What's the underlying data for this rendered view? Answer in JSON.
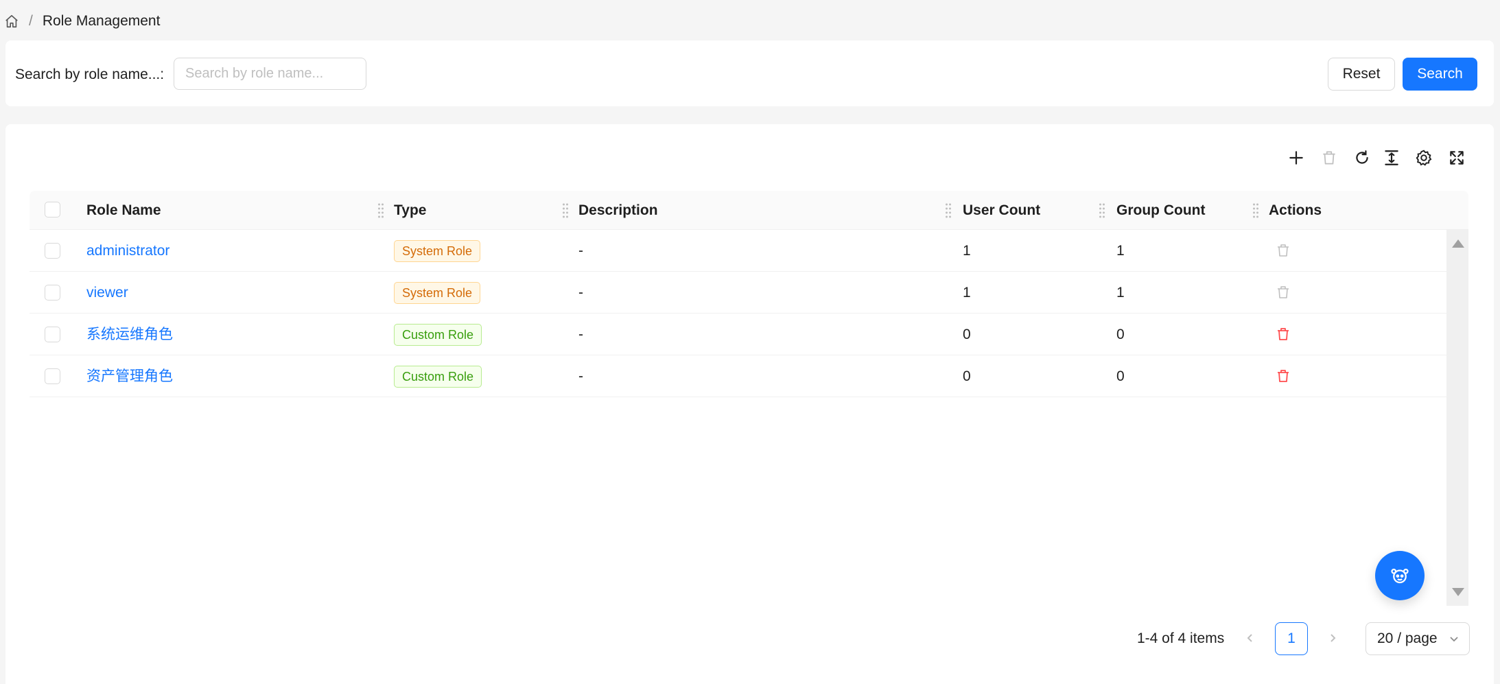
{
  "breadcrumb": {
    "separator": "/",
    "current": "Role Management"
  },
  "search": {
    "label": "Search by role name...:",
    "placeholder": "Search by role name...",
    "value": "",
    "reset_label": "Reset",
    "search_label": "Search"
  },
  "toolbar": {
    "icons": [
      "plus-icon",
      "trash-icon",
      "reload-icon",
      "column-height-icon",
      "setting-icon",
      "fullscreen-icon"
    ]
  },
  "table": {
    "columns": [
      "Role Name",
      "Type",
      "Description",
      "User Count",
      "Group Count",
      "Actions"
    ],
    "rows": [
      {
        "name": "administrator",
        "type": "System Role",
        "type_kind": "system",
        "description": "-",
        "user_count": "1",
        "group_count": "1",
        "delete_enabled": false
      },
      {
        "name": "viewer",
        "type": "System Role",
        "type_kind": "system",
        "description": "-",
        "user_count": "1",
        "group_count": "1",
        "delete_enabled": false
      },
      {
        "name": "系统运维角色",
        "type": "Custom Role",
        "type_kind": "custom",
        "description": "-",
        "user_count": "0",
        "group_count": "0",
        "delete_enabled": true
      },
      {
        "name": "资产管理角色",
        "type": "Custom Role",
        "type_kind": "custom",
        "description": "-",
        "user_count": "0",
        "group_count": "0",
        "delete_enabled": true
      }
    ]
  },
  "pagination": {
    "total_text": "1-4 of 4 items",
    "current_page": "1",
    "page_size": "20 / page"
  },
  "colors": {
    "primary": "#1677ff",
    "danger": "#ff4d4f",
    "disabled": "#bfbfbf"
  }
}
